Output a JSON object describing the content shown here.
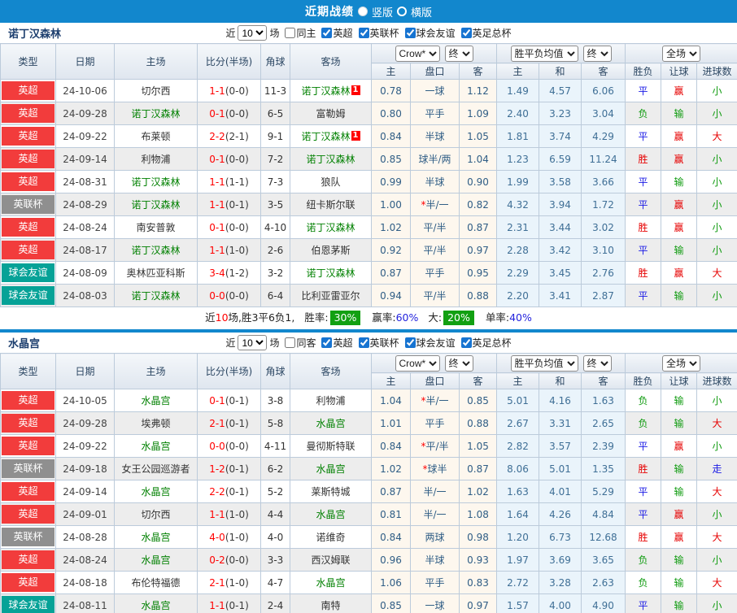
{
  "titlebar": {
    "title": "近期战绩",
    "vertical_label": "竖版",
    "horizontal_label": "横版"
  },
  "table_header": {
    "type": "类型",
    "date": "日期",
    "home": "主场",
    "score": "比分(半场)",
    "corner": "角球",
    "away": "客场",
    "odds_company": "Crow*",
    "odds_state": "终",
    "avg_label": "胜平负均值",
    "avg_state": "终",
    "scope": "全场",
    "sub": [
      "主",
      "盘口",
      "客",
      "主",
      "和",
      "客",
      "胜负",
      "让球",
      "进球数"
    ]
  },
  "league_colors": {
    "英超": "#f23c3c",
    "英联杯": "#8f8f8f",
    "球会友谊": "#06a297"
  },
  "result_colors": {
    "胜": "#e60000",
    "赢": "#e60000",
    "大": "#e60000",
    "平": "#1a1ae6",
    "走": "#1a1ae6",
    "负": "#0f9b0f",
    "输": "#0f9b0f",
    "小": "#0f9b0f"
  },
  "sections": [
    {
      "team": "诺丁汉森林",
      "filter": {
        "near": "近",
        "games": "10",
        "games_label": "场",
        "same": "同主",
        "leagues": [
          "英超",
          "英联杯",
          "球会友谊",
          "英足总杯"
        ]
      },
      "rows": [
        {
          "league": "英超",
          "date": "24-10-06",
          "home": "切尔西",
          "home_hl": false,
          "ft": "1-1",
          "ht": "(0-0)",
          "corner": "11-3",
          "away": "诺丁汉森林",
          "away_hl": true,
          "away_badge": "1",
          "o_home": "0.78",
          "star": false,
          "hcap": "一球",
          "o_away": "1.12",
          "avg_home": "1.49",
          "avg_draw": "4.57",
          "avg_away": "6.06",
          "res_wdl": "平",
          "res_hcap": "赢",
          "res_goal": "小"
        },
        {
          "league": "英超",
          "date": "24-09-28",
          "home": "诺丁汉森林",
          "home_hl": true,
          "ft": "0-1",
          "ht": "(0-0)",
          "corner": "6-5",
          "away": "富勒姆",
          "away_hl": false,
          "o_home": "0.80",
          "star": false,
          "hcap": "平手",
          "o_away": "1.09",
          "avg_home": "2.40",
          "avg_draw": "3.23",
          "avg_away": "3.04",
          "res_wdl": "负",
          "res_hcap": "输",
          "res_goal": "小"
        },
        {
          "league": "英超",
          "date": "24-09-22",
          "home": "布莱顿",
          "home_hl": false,
          "ft": "2-2",
          "ht": "(2-1)",
          "corner": "9-1",
          "away": "诺丁汉森林",
          "away_hl": true,
          "away_badge": "1",
          "o_home": "0.84",
          "star": false,
          "hcap": "半球",
          "o_away": "1.05",
          "avg_home": "1.81",
          "avg_draw": "3.74",
          "avg_away": "4.29",
          "res_wdl": "平",
          "res_hcap": "赢",
          "res_goal": "大"
        },
        {
          "league": "英超",
          "date": "24-09-14",
          "home": "利物浦",
          "home_hl": false,
          "ft": "0-1",
          "ht": "(0-0)",
          "corner": "7-2",
          "away": "诺丁汉森林",
          "away_hl": true,
          "o_home": "0.85",
          "star": false,
          "hcap": "球半/两",
          "o_away": "1.04",
          "avg_home": "1.23",
          "avg_draw": "6.59",
          "avg_away": "11.24",
          "res_wdl": "胜",
          "res_hcap": "赢",
          "res_goal": "小"
        },
        {
          "league": "英超",
          "date": "24-08-31",
          "home": "诺丁汉森林",
          "home_hl": true,
          "ft": "1-1",
          "ht": "(1-1)",
          "corner": "7-3",
          "away": "狼队",
          "away_hl": false,
          "o_home": "0.99",
          "star": false,
          "hcap": "半球",
          "o_away": "0.90",
          "avg_home": "1.99",
          "avg_draw": "3.58",
          "avg_away": "3.66",
          "res_wdl": "平",
          "res_hcap": "输",
          "res_goal": "小"
        },
        {
          "league": "英联杯",
          "date": "24-08-29",
          "home": "诺丁汉森林",
          "home_hl": true,
          "ft": "1-1",
          "ht": "(0-1)",
          "corner": "3-5",
          "away": "纽卡斯尔联",
          "away_hl": false,
          "o_home": "1.00",
          "star": true,
          "hcap": "半/一",
          "o_away": "0.82",
          "avg_home": "4.32",
          "avg_draw": "3.94",
          "avg_away": "1.72",
          "res_wdl": "平",
          "res_hcap": "赢",
          "res_goal": "小"
        },
        {
          "league": "英超",
          "date": "24-08-24",
          "home": "南安普敦",
          "home_hl": false,
          "ft": "0-1",
          "ht": "(0-0)",
          "corner": "4-10",
          "away": "诺丁汉森林",
          "away_hl": true,
          "o_home": "1.02",
          "star": false,
          "hcap": "平/半",
          "o_away": "0.87",
          "avg_home": "2.31",
          "avg_draw": "3.44",
          "avg_away": "3.02",
          "res_wdl": "胜",
          "res_hcap": "赢",
          "res_goal": "小"
        },
        {
          "league": "英超",
          "date": "24-08-17",
          "home": "诺丁汉森林",
          "home_hl": true,
          "ft": "1-1",
          "ht": "(1-0)",
          "corner": "2-6",
          "away": "伯恩茅斯",
          "away_hl": false,
          "o_home": "0.92",
          "star": false,
          "hcap": "平/半",
          "o_away": "0.97",
          "avg_home": "2.28",
          "avg_draw": "3.42",
          "avg_away": "3.10",
          "res_wdl": "平",
          "res_hcap": "输",
          "res_goal": "小"
        },
        {
          "league": "球会友谊",
          "date": "24-08-09",
          "home": "奥林匹亚科斯",
          "home_hl": false,
          "ft": "3-4",
          "ht": "(1-2)",
          "corner": "3-2",
          "away": "诺丁汉森林",
          "away_hl": true,
          "o_home": "0.87",
          "star": false,
          "hcap": "平手",
          "o_away": "0.95",
          "avg_home": "2.29",
          "avg_draw": "3.45",
          "avg_away": "2.76",
          "res_wdl": "胜",
          "res_hcap": "赢",
          "res_goal": "大"
        },
        {
          "league": "球会友谊",
          "date": "24-08-03",
          "home": "诺丁汉森林",
          "home_hl": true,
          "ft": "0-0",
          "ht": "(0-0)",
          "corner": "6-4",
          "away": "比利亚雷亚尔",
          "away_hl": false,
          "o_home": "0.94",
          "star": false,
          "hcap": "平/半",
          "o_away": "0.88",
          "avg_home": "2.20",
          "avg_draw": "3.41",
          "avg_away": "2.87",
          "res_wdl": "平",
          "res_hcap": "输",
          "res_goal": "小"
        }
      ],
      "summary": {
        "text_near": "近",
        "games": "10",
        "text_record": "场,胜3平6负1,",
        "win_label": "胜率:",
        "win_rate": "30%",
        "handicap_label": "赢率:",
        "handicap_rate": "60%",
        "big_label": "大:",
        "big_rate": "20%",
        "single_label": "单率:",
        "single_rate": "40%"
      }
    },
    {
      "team": "水晶宫",
      "filter": {
        "near": "近",
        "games": "10",
        "games_label": "场",
        "same": "同客",
        "leagues": [
          "英超",
          "英联杯",
          "球会友谊",
          "英足总杯"
        ]
      },
      "rows": [
        {
          "league": "英超",
          "date": "24-10-05",
          "home": "水晶宫",
          "home_hl": true,
          "ft": "0-1",
          "ht": "(0-1)",
          "corner": "3-8",
          "away": "利物浦",
          "away_hl": false,
          "o_home": "1.04",
          "star": true,
          "hcap": "半/一",
          "o_away": "0.85",
          "avg_home": "5.01",
          "avg_draw": "4.16",
          "avg_away": "1.63",
          "res_wdl": "负",
          "res_hcap": "输",
          "res_goal": "小"
        },
        {
          "league": "英超",
          "date": "24-09-28",
          "home": "埃弗顿",
          "home_hl": false,
          "ft": "2-1",
          "ht": "(0-1)",
          "corner": "5-8",
          "away": "水晶宫",
          "away_hl": true,
          "o_home": "1.01",
          "star": false,
          "hcap": "平手",
          "o_away": "0.88",
          "avg_home": "2.67",
          "avg_draw": "3.31",
          "avg_away": "2.65",
          "res_wdl": "负",
          "res_hcap": "输",
          "res_goal": "大"
        },
        {
          "league": "英超",
          "date": "24-09-22",
          "home": "水晶宫",
          "home_hl": true,
          "ft": "0-0",
          "ht": "(0-0)",
          "corner": "4-11",
          "away": "曼彻斯特联",
          "away_hl": false,
          "o_home": "0.84",
          "star": true,
          "hcap": "平/半",
          "o_away": "1.05",
          "avg_home": "2.82",
          "avg_draw": "3.57",
          "avg_away": "2.39",
          "res_wdl": "平",
          "res_hcap": "赢",
          "res_goal": "小"
        },
        {
          "league": "英联杯",
          "date": "24-09-18",
          "home": "女王公园巡游者",
          "home_hl": false,
          "ft": "1-2",
          "ht": "(0-1)",
          "corner": "6-2",
          "away": "水晶宫",
          "away_hl": true,
          "o_home": "1.02",
          "star": true,
          "hcap": "球半",
          "o_away": "0.87",
          "avg_home": "8.06",
          "avg_draw": "5.01",
          "avg_away": "1.35",
          "res_wdl": "胜",
          "res_hcap": "输",
          "res_goal": "走"
        },
        {
          "league": "英超",
          "date": "24-09-14",
          "home": "水晶宫",
          "home_hl": true,
          "ft": "2-2",
          "ht": "(0-1)",
          "corner": "5-2",
          "away": "莱斯特城",
          "away_hl": false,
          "o_home": "0.87",
          "star": false,
          "hcap": "半/一",
          "o_away": "1.02",
          "avg_home": "1.63",
          "avg_draw": "4.01",
          "avg_away": "5.29",
          "res_wdl": "平",
          "res_hcap": "输",
          "res_goal": "大"
        },
        {
          "league": "英超",
          "date": "24-09-01",
          "home": "切尔西",
          "home_hl": false,
          "ft": "1-1",
          "ht": "(1-0)",
          "corner": "4-4",
          "away": "水晶宫",
          "away_hl": true,
          "o_home": "0.81",
          "star": false,
          "hcap": "半/一",
          "o_away": "1.08",
          "avg_home": "1.64",
          "avg_draw": "4.26",
          "avg_away": "4.84",
          "res_wdl": "平",
          "res_hcap": "赢",
          "res_goal": "小"
        },
        {
          "league": "英联杯",
          "date": "24-08-28",
          "home": "水晶宫",
          "home_hl": true,
          "ft": "4-0",
          "ht": "(1-0)",
          "corner": "4-0",
          "away": "诺维奇",
          "away_hl": false,
          "o_home": "0.84",
          "star": false,
          "hcap": "两球",
          "o_away": "0.98",
          "avg_home": "1.20",
          "avg_draw": "6.73",
          "avg_away": "12.68",
          "res_wdl": "胜",
          "res_hcap": "赢",
          "res_goal": "大"
        },
        {
          "league": "英超",
          "date": "24-08-24",
          "home": "水晶宫",
          "home_hl": true,
          "ft": "0-2",
          "ht": "(0-0)",
          "corner": "3-3",
          "away": "西汉姆联",
          "away_hl": false,
          "o_home": "0.96",
          "star": false,
          "hcap": "半球",
          "o_away": "0.93",
          "avg_home": "1.97",
          "avg_draw": "3.69",
          "avg_away": "3.65",
          "res_wdl": "负",
          "res_hcap": "输",
          "res_goal": "小"
        },
        {
          "league": "英超",
          "date": "24-08-18",
          "home": "布伦特福德",
          "home_hl": false,
          "ft": "2-1",
          "ht": "(1-0)",
          "corner": "4-7",
          "away": "水晶宫",
          "away_hl": true,
          "o_home": "1.06",
          "star": false,
          "hcap": "平手",
          "o_away": "0.83",
          "avg_home": "2.72",
          "avg_draw": "3.28",
          "avg_away": "2.63",
          "res_wdl": "负",
          "res_hcap": "输",
          "res_goal": "大"
        },
        {
          "league": "球会友谊",
          "date": "24-08-11",
          "home": "水晶宫",
          "home_hl": true,
          "ft": "1-1",
          "ht": "(0-1)",
          "corner": "2-4",
          "away": "南特",
          "away_hl": false,
          "o_home": "0.85",
          "star": false,
          "hcap": "一球",
          "o_away": "0.97",
          "avg_home": "1.57",
          "avg_draw": "4.00",
          "avg_away": "4.90",
          "res_wdl": "平",
          "res_hcap": "输",
          "res_goal": "小"
        }
      ]
    }
  ]
}
